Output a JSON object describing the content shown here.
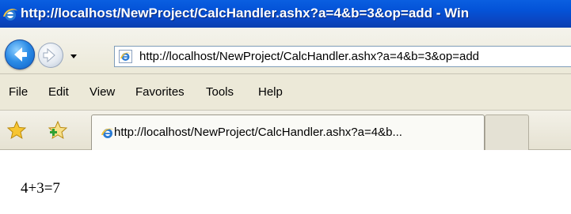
{
  "window": {
    "title": "http://localhost/NewProject/CalcHandler.ashx?a=4&b=3&op=add - Win"
  },
  "address_bar": {
    "url": "http://localhost/NewProject/CalcHandler.ashx?a=4&b=3&op=add"
  },
  "menu": {
    "items": [
      "File",
      "Edit",
      "View",
      "Favorites",
      "Tools",
      "Help"
    ]
  },
  "tabs": {
    "active_title": "http://localhost/NewProject/CalcHandler.ashx?a=4&b..."
  },
  "page": {
    "content": "4+3=7"
  },
  "icons": {
    "back": "back-arrow-icon",
    "forward": "forward-arrow-icon",
    "favorites": "favorites-star-icon",
    "add_favorite": "add-favorite-icon",
    "browser": "ie-icon"
  },
  "colors": {
    "titlebar": "#0453d8",
    "chrome": "#ece9d8"
  }
}
